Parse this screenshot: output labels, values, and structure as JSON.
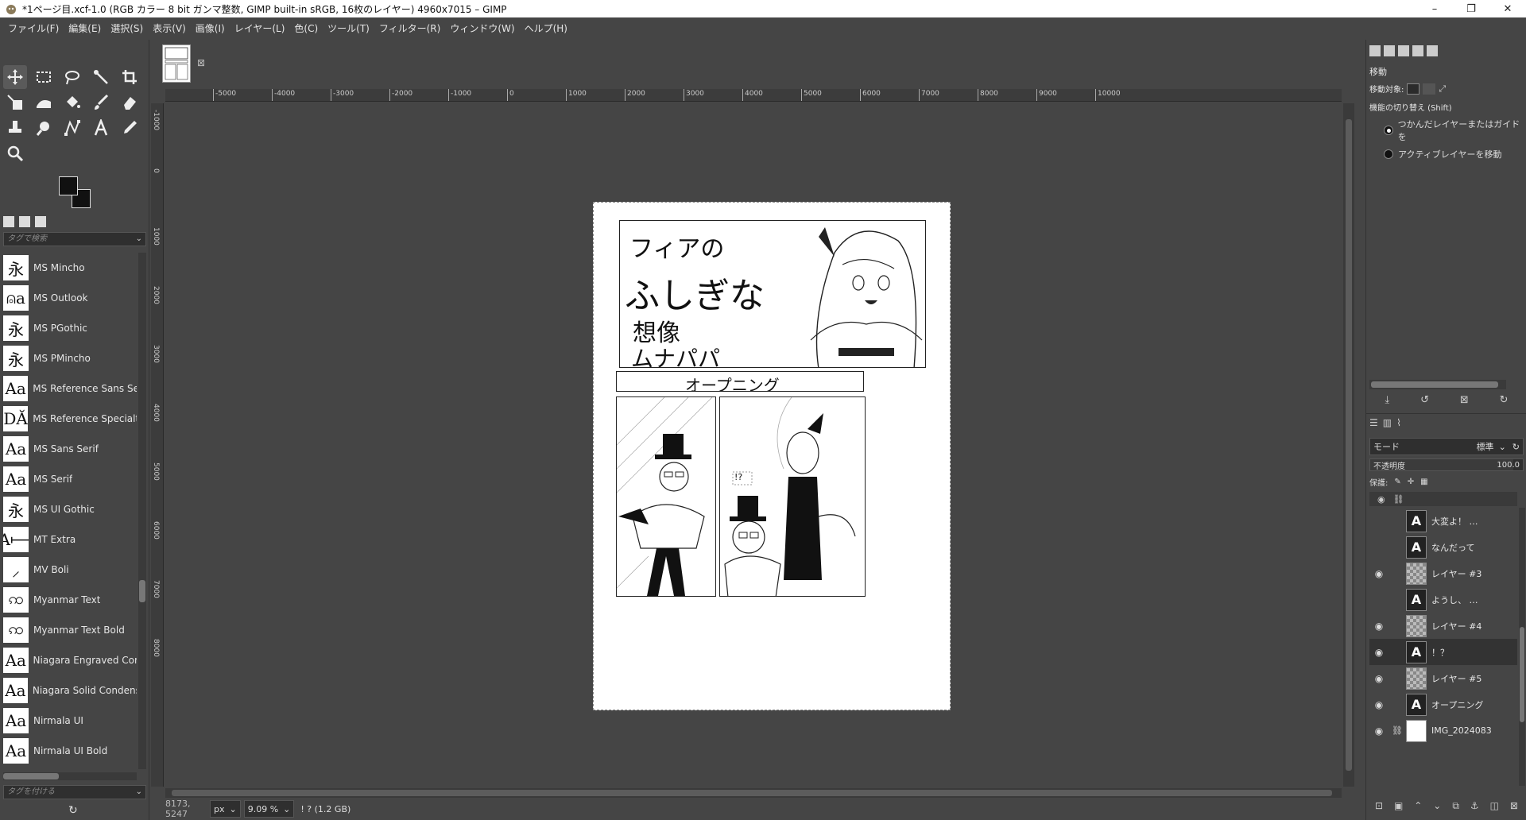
{
  "window": {
    "title": "*1ページ目.xcf-1.0 (RGB カラー 8 bit ガンマ整数, GIMP built-in sRGB, 16枚のレイヤー) 4960x7015 – GIMP",
    "minimize": "–",
    "maximize": "❐",
    "close": "✕"
  },
  "menu": [
    "ファイル(F)",
    "編集(E)",
    "選択(S)",
    "表示(V)",
    "画像(I)",
    "レイヤー(L)",
    "色(C)",
    "ツール(T)",
    "フィルター(R)",
    "ウィンドウ(W)",
    "ヘルプ(H)"
  ],
  "fonts": {
    "search_placeholder": "タグで検索",
    "tag_placeholder": "タグを付ける",
    "items": [
      {
        "preview": "永",
        "name": "MS Mincho"
      },
      {
        "preview": "⍝a",
        "name": "MS Outlook"
      },
      {
        "preview": "永",
        "name": "MS PGothic"
      },
      {
        "preview": "永",
        "name": "MS PMincho"
      },
      {
        "preview": "Aa",
        "name": "MS Reference Sans Se"
      },
      {
        "preview": "DĂ",
        "name": "MS Reference Specialt"
      },
      {
        "preview": "Aa",
        "name": "MS Sans Serif"
      },
      {
        "preview": "Aa",
        "name": "MS Serif"
      },
      {
        "preview": "永",
        "name": "MS UI Gothic"
      },
      {
        "preview": "A⟼",
        "name": "MT Extra"
      },
      {
        "preview": "⸝",
        "name": "MV Boli"
      },
      {
        "preview": "ꩡ",
        "name": "Myanmar Text"
      },
      {
        "preview": "ꩡ",
        "name": "Myanmar Text Bold"
      },
      {
        "preview": "Aa",
        "name": "Niagara Engraved Cor"
      },
      {
        "preview": "Aa",
        "name": "Niagara Solid Condens"
      },
      {
        "preview": "Aa",
        "name": "Nirmala UI"
      },
      {
        "preview": "Aa",
        "name": "Nirmala UI Bold"
      }
    ]
  },
  "ruler": {
    "h_labels": [
      "-5000",
      "-4000",
      "-3000",
      "-2000",
      "-1000",
      "0",
      "1000",
      "2000",
      "3000",
      "4000",
      "5000",
      "6000",
      "7000",
      "8000",
      "9000",
      "10000"
    ],
    "v_labels": [
      "-1000",
      "0",
      "1000",
      "2000",
      "3000",
      "4000",
      "5000",
      "6000",
      "7000",
      "8000"
    ]
  },
  "manga": {
    "title1": "フィアの",
    "title2": "ふしぎな",
    "title3": "想像",
    "author": "ムナパパ",
    "chapter": "オープニング",
    "speech": "!?"
  },
  "status": {
    "coords": "8173, 5247",
    "unit": "px",
    "zoom": "9.09 %",
    "info": "! ? (1.2 GB)"
  },
  "tool_options": {
    "title": "移動",
    "move_target_label": "移動対象:",
    "switch_label": "機能の切り替え (Shift)",
    "option1": "つかんだレイヤーまたはガイドを",
    "option2": "アクティブレイヤーを移動"
  },
  "layers": {
    "mode_label": "モード",
    "mode_value": "標準",
    "opacity_label": "不透明度",
    "opacity_value": "100.0",
    "lock_label": "保護:",
    "items": [
      {
        "name": "大変よ！ …",
        "type": "text",
        "visible": false,
        "chain": false
      },
      {
        "name": "なんだって",
        "type": "text",
        "visible": false,
        "chain": false
      },
      {
        "name": "レイヤー #3",
        "type": "raster",
        "visible": true,
        "chain": false
      },
      {
        "name": "ようし、 …",
        "type": "text",
        "visible": false,
        "chain": false
      },
      {
        "name": "レイヤー #4",
        "type": "raster",
        "visible": true,
        "chain": false
      },
      {
        "name": "！？",
        "type": "text",
        "visible": true,
        "chain": false,
        "active": true
      },
      {
        "name": "レイヤー #5",
        "type": "raster",
        "visible": true,
        "chain": false
      },
      {
        "name": "オープニング",
        "type": "text",
        "visible": true,
        "chain": false
      },
      {
        "name": "IMG_2024083",
        "type": "image",
        "visible": true,
        "chain": true
      }
    ]
  }
}
